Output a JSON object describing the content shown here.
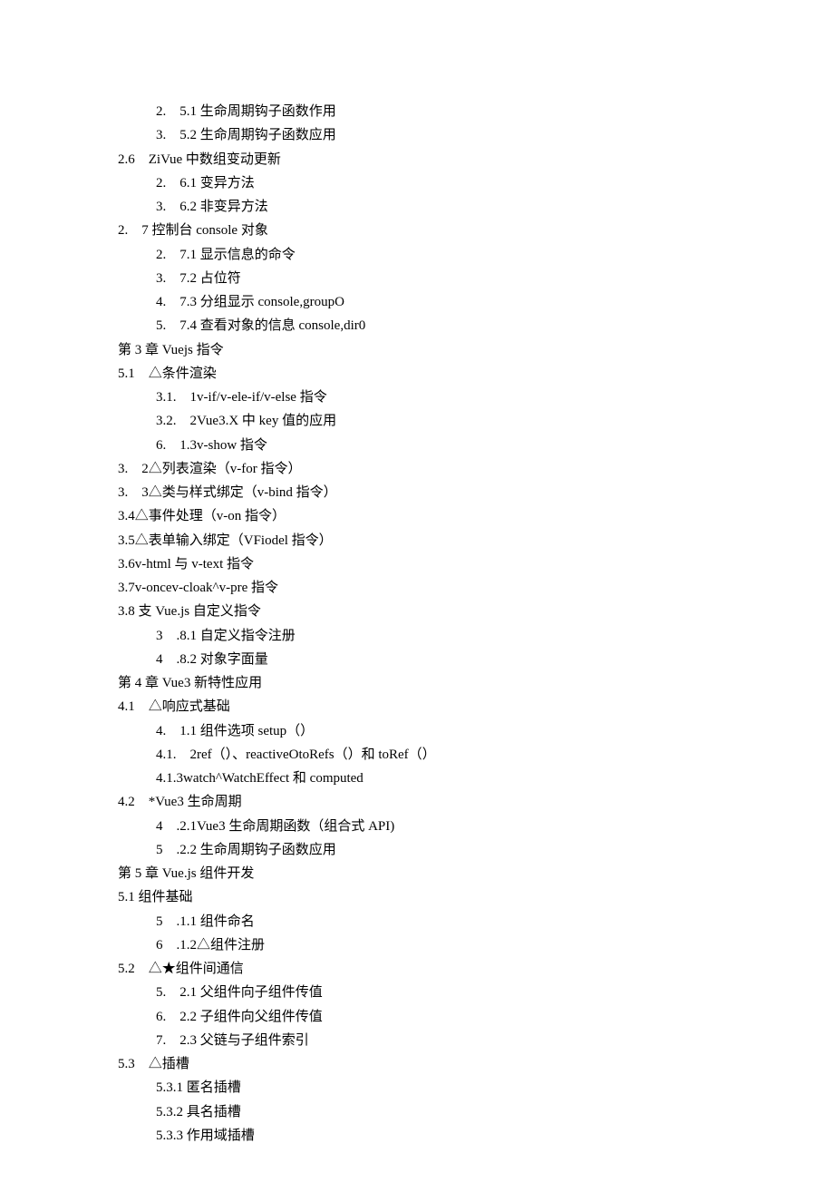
{
  "lines": [
    {
      "indent": "l1",
      "text": "2.　5.1 生命周期钩子函数作用"
    },
    {
      "indent": "l1",
      "text": "3.　5.2 生命周期钩子函数应用"
    },
    {
      "indent": "l0",
      "text": "2.6　ZiVue 中数组变动更新"
    },
    {
      "indent": "l1",
      "text": "2.　6.1 变异方法"
    },
    {
      "indent": "l1",
      "text": "3.　6.2 非变异方法"
    },
    {
      "indent": "l0",
      "text": "2.　7 控制台 console 对象"
    },
    {
      "indent": "l1",
      "text": "2.　7.1 显示信息的命令"
    },
    {
      "indent": "l1",
      "text": "3.　7.2 占位符"
    },
    {
      "indent": "l1",
      "text": "4.　7.3 分组显示 console,groupO"
    },
    {
      "indent": "l1",
      "text": "5.　7.4 查看对象的信息 console,dir0"
    },
    {
      "indent": "l0",
      "text": "第 3 章 Vuejs 指令"
    },
    {
      "indent": "l0",
      "text": "5.1　△条件渲染"
    },
    {
      "indent": "l1",
      "text": "3.1.　1v-if/v-ele-if/v-else 指令"
    },
    {
      "indent": "l1",
      "text": "3.2.　2Vue3.X 中 key 值的应用"
    },
    {
      "indent": "l1",
      "text": "6.　1.3v-show 指令"
    },
    {
      "indent": "l0",
      "text": "3.　2△列表渲染（v-for 指令）"
    },
    {
      "indent": "l0",
      "text": "3.　3△类与样式绑定（v-bind 指令）"
    },
    {
      "indent": "l0",
      "text": "3.4△事件处理（v-on 指令）"
    },
    {
      "indent": "l0",
      "text": "3.5△表单输入绑定（VFiodel 指令）"
    },
    {
      "indent": "l0",
      "text": "3.6v-html 与 v-text 指令"
    },
    {
      "indent": "l0",
      "text": "3.7v-oncev-cloak^v-pre 指令"
    },
    {
      "indent": "l0",
      "text": "3.8 支 Vue.js 自定义指令"
    },
    {
      "indent": "l1",
      "text": "3　.8.1 自定义指令注册"
    },
    {
      "indent": "l1",
      "text": "4　.8.2 对象字面量"
    },
    {
      "indent": "l0",
      "text": "第 4 章 Vue3 新特性应用"
    },
    {
      "indent": "l0",
      "text": "4.1　△响应式基础"
    },
    {
      "indent": "l1",
      "text": "4.　1.1 组件选项 setup（）"
    },
    {
      "indent": "l1",
      "text": "4.1.　2ref（）、reactiveOtoRefs（）和 toRef（）"
    },
    {
      "indent": "l1",
      "text": "4.1.3watch^WatchEffect 和 computed"
    },
    {
      "indent": "l0",
      "text": "4.2　*Vue3 生命周期"
    },
    {
      "indent": "l1",
      "text": "4　.2.1Vue3 生命周期函数（组合式 API)"
    },
    {
      "indent": "l1",
      "text": "5　.2.2 生命周期钩子函数应用"
    },
    {
      "indent": "l0",
      "text": "第 5 章 Vue.js 组件开发"
    },
    {
      "indent": "l0",
      "text": "5.1 组件基础"
    },
    {
      "indent": "l1",
      "text": "5　.1.1 组件命名"
    },
    {
      "indent": "l1",
      "text": "6　.1.2△组件注册"
    },
    {
      "indent": "l0",
      "text": "5.2　△★组件间通信"
    },
    {
      "indent": "l1",
      "text": "5.　2.1 父组件向子组件传值"
    },
    {
      "indent": "l1",
      "text": "6.　2.2 子组件向父组件传值"
    },
    {
      "indent": "l1",
      "text": "7.　2.3 父链与子组件索引"
    },
    {
      "indent": "l0",
      "text": "5.3　△插槽"
    },
    {
      "indent": "l1",
      "text": "5.3.1 匿名插槽"
    },
    {
      "indent": "l1",
      "text": "5.3.2 具名插槽"
    },
    {
      "indent": "l1",
      "text": "5.3.3 作用域插槽"
    }
  ]
}
